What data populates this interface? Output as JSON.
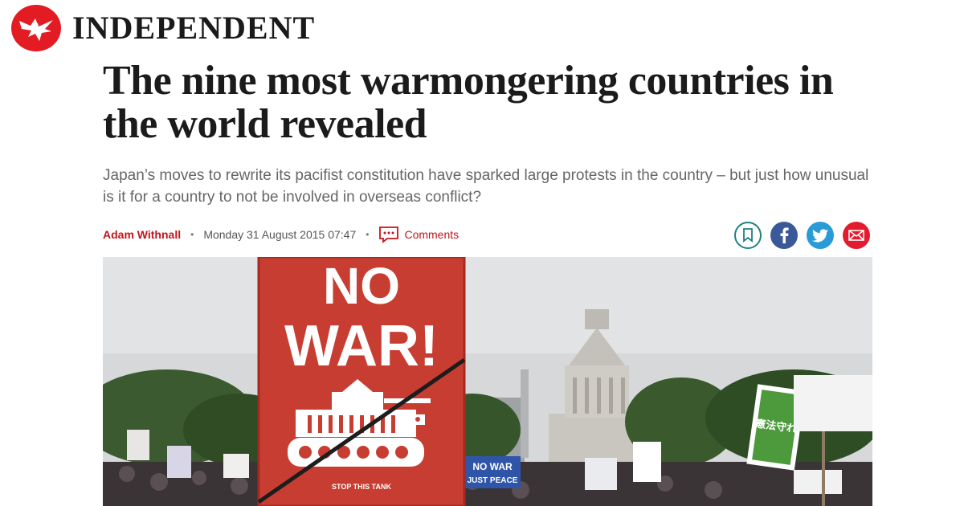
{
  "masthead": {
    "name": "INDEPENDENT",
    "logo_icon": "eagle-icon",
    "brand_color": "#e31b23"
  },
  "article": {
    "headline": "The nine most warmongering countries in the world revealed",
    "standfirst": "Japan’s moves to rewrite its pacifist constitution have sparked large protests in the country – but just how unusual is it for a country to not be involved in overseas conflict?",
    "author": "Adam Withnall",
    "date": "Monday 31 August 2015 07:47",
    "comments_label": "Comments",
    "separator": "•"
  },
  "share": {
    "icons": [
      "bookmark-icon",
      "facebook-icon",
      "twitter-icon",
      "email-icon"
    ]
  },
  "photo": {
    "sign": {
      "line1": "NO",
      "line2": "WAR!",
      "caption": "STOP THIS TANK"
    },
    "placards": {
      "sign_a": "NO WAR",
      "sign_b": "JUST PEACE",
      "green_sign": "憲法守れ"
    }
  }
}
